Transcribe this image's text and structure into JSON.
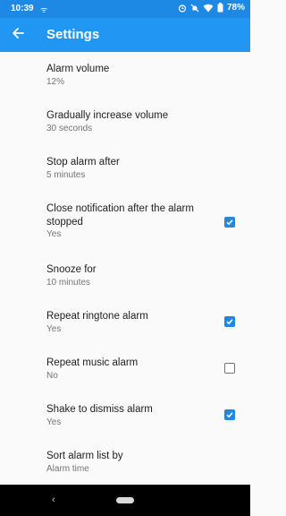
{
  "status": {
    "time": "10:39",
    "battery": "78%"
  },
  "appbar": {
    "title": "Settings"
  },
  "settings": [
    {
      "title": "Alarm volume",
      "summary": "12%"
    },
    {
      "title": "Gradually increase volume",
      "summary": "30 seconds"
    },
    {
      "title": "Stop alarm after",
      "summary": "5 minutes"
    },
    {
      "title": "Close notification after the alarm stopped",
      "summary": "Yes",
      "checked": true
    },
    {
      "title": "Snooze for",
      "summary": "10 minutes"
    },
    {
      "title": "Repeat ringtone alarm",
      "summary": "Yes",
      "checked": true
    },
    {
      "title": "Repeat music alarm",
      "summary": "No",
      "checked": false
    },
    {
      "title": "Shake to dismiss alarm",
      "summary": "Yes",
      "checked": true
    },
    {
      "title": "Sort alarm list by",
      "summary": "Alarm time"
    }
  ],
  "colors": {
    "primary": "#2196F3",
    "status": "#1E88E5"
  }
}
